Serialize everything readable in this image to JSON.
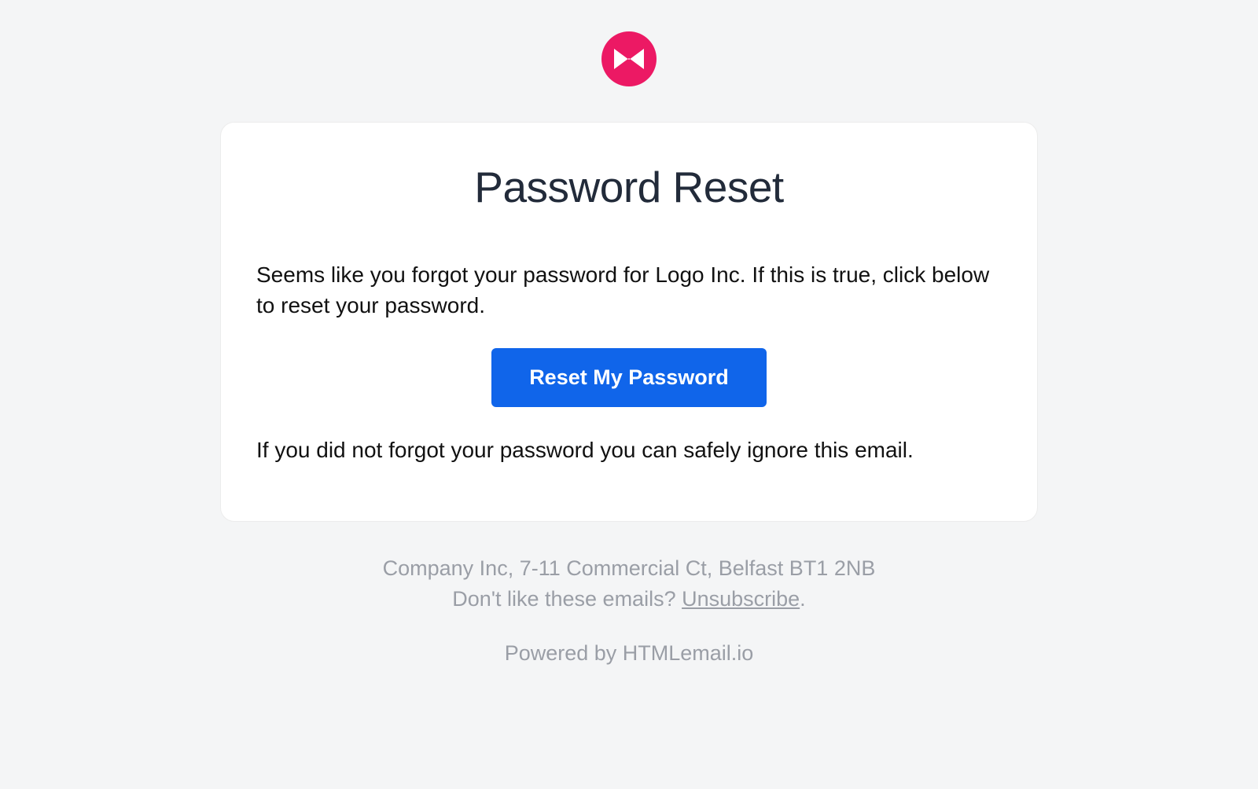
{
  "logo": {
    "name": "bowtie-logo",
    "color": "#e91e63"
  },
  "card": {
    "title": "Password Reset",
    "intro_text": "Seems like you forgot your password for Logo Inc. If this is true, click below to reset your password.",
    "button_label": "Reset My Password",
    "ignore_text": "If you did not forgot your password you can safely ignore this email."
  },
  "footer": {
    "address": "Company Inc, 7-11 Commercial Ct, Belfast BT1 2NB",
    "unsubscribe_prompt": "Don't like these emails? ",
    "unsubscribe_label": "Unsubscribe",
    "unsubscribe_suffix": ".",
    "powered_by": "Powered by HTMLemail.io"
  }
}
